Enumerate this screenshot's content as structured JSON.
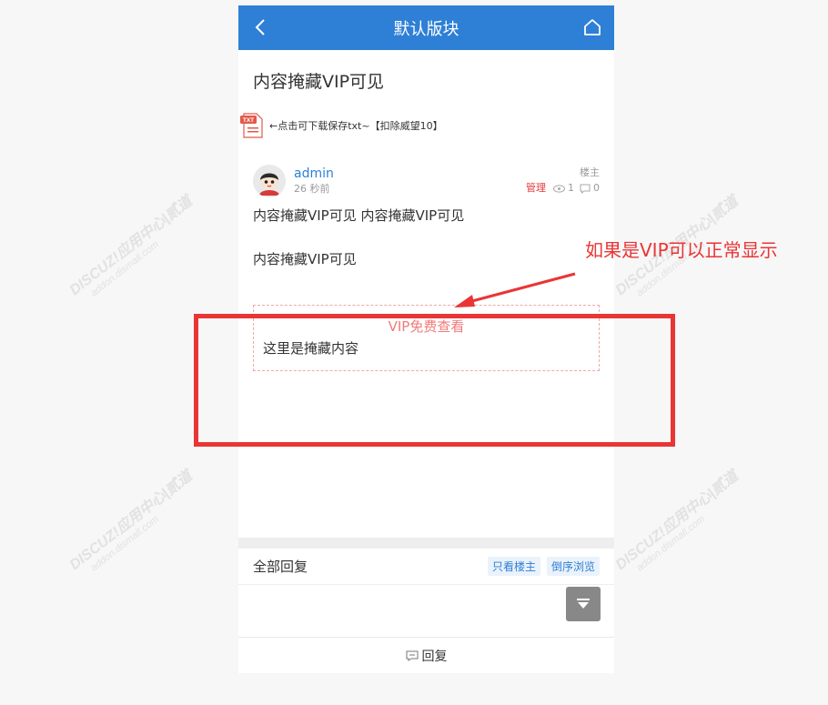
{
  "topbar": {
    "title": "默认版块",
    "back_icon": "chevron-left-icon",
    "home_icon": "home-icon"
  },
  "thread": {
    "title": "内容掩藏VIP可见",
    "attachment_text": "←点击可下载保存txt~【扣除威望10】",
    "attachment_icon_label": "TXT"
  },
  "post": {
    "author": "admin",
    "time": "26 秒前",
    "floor": "楼主",
    "manage": "管理",
    "views": "1",
    "replies": "0",
    "line1": "内容掩藏VIP可见 内容掩藏VIP可见",
    "line2": "内容掩藏VIP可见"
  },
  "hidden_box": {
    "vip_label": "VIP免费查看",
    "content": "这里是掩藏内容"
  },
  "replies": {
    "label": "全部回复",
    "only_author": "只看楼主",
    "reverse": "倒序浏览"
  },
  "footer": {
    "reply_label": "回复"
  },
  "annotation": {
    "text": "如果是VIP可以正常显示",
    "color": "#ea3535"
  },
  "watermark": {
    "main": "DISCUZ!应用中心|贰道",
    "sub": "addon.dismall.com"
  },
  "colors": {
    "brand": "#2e7fd6",
    "vip": "#f07a7a"
  }
}
